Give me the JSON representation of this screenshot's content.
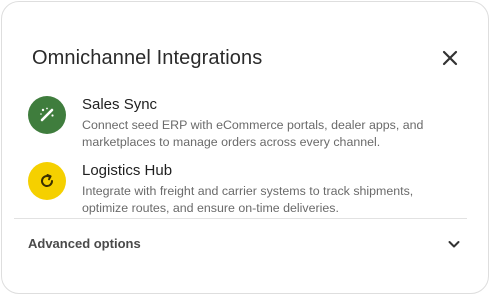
{
  "dialog": {
    "title": "Omnichannel Integrations",
    "close_icon": "close-icon"
  },
  "integrations": [
    {
      "title": "Sales Sync",
      "description": "Connect seed ERP with eCommerce portals, dealer apps, and marketplaces to manage orders across every channel.",
      "icon": "magic-wand-icon",
      "icon_bg": "#3f7d3d"
    },
    {
      "title": "Logistics Hub",
      "description": "Integrate with freight and carrier systems to track shipments, optimize routes, and ensure on-time deliveries.",
      "icon": "sync-icon",
      "icon_bg": "#f5d000"
    }
  ],
  "advanced": {
    "label": "Advanced options",
    "icon": "chevron-down-icon"
  }
}
